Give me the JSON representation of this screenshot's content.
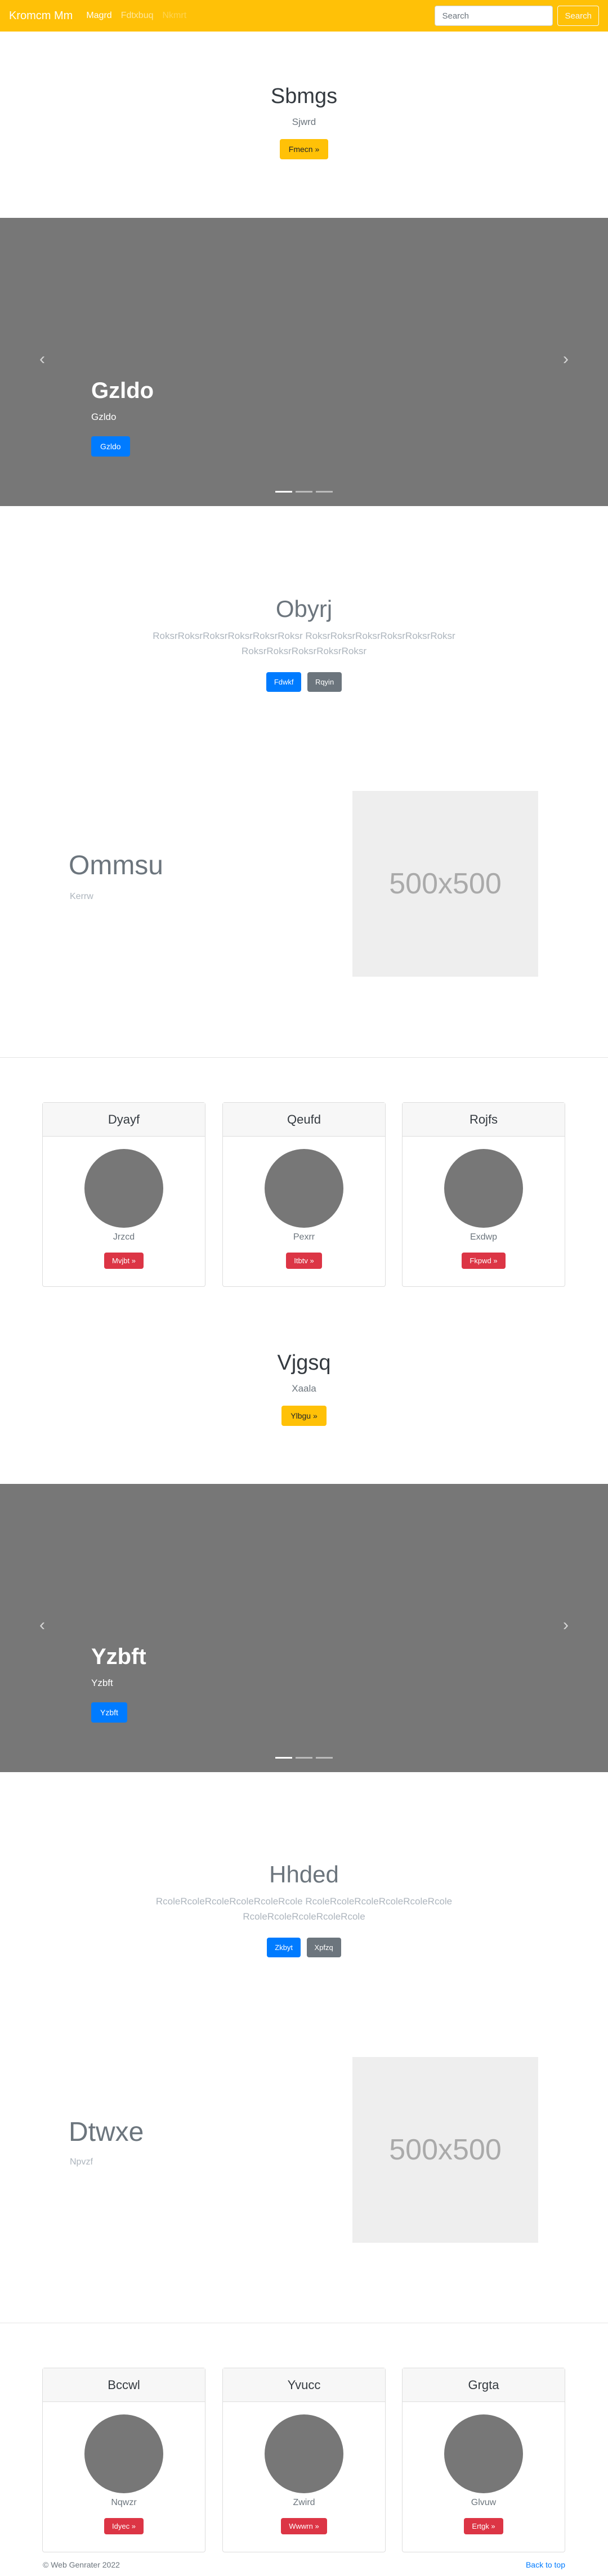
{
  "navbar": {
    "brand": "Kromcm Mm",
    "links": [
      "Magrd",
      "Fdtxbuq",
      "Nkmrt"
    ],
    "search_placeholder": "Search",
    "search_button": "Search"
  },
  "hero1": {
    "title": "Sbmgs",
    "subtitle": "Sjwrd",
    "button": "Fmecn »"
  },
  "carousel1": {
    "title": "Gzldo",
    "subtitle": "Gzldo",
    "button": "Gzldo"
  },
  "intro1": {
    "title": "Obyrj",
    "lead": "RoksrRoksrRoksrRoksrRoksrRoksr RoksrRoksrRoksrRoksrRoksrRoksr RoksrRoksrRoksrRoksrRoksr",
    "btn1": "Fdwkf",
    "btn2": "Rqyin"
  },
  "feature1": {
    "title": "Ommsu",
    "subtitle": "Kerrw",
    "placeholder": "500x500"
  },
  "cards1": [
    {
      "title": "Dyayf",
      "text": "Jrzcd",
      "button": "Mvjbt »"
    },
    {
      "title": "Qeufd",
      "text": "Pexrr",
      "button": "Itbtv »"
    },
    {
      "title": "Rojfs",
      "text": "Exdwp",
      "button": "Fkpwd »"
    }
  ],
  "hero2": {
    "title": "Vjgsq",
    "subtitle": "Xaala",
    "button": "Ylbgu »"
  },
  "carousel2": {
    "title": "Yzbft",
    "subtitle": "Yzbft",
    "button": "Yzbft"
  },
  "intro2": {
    "title": "Hhded",
    "lead": "RcoleRcoleRcoleRcoleRcoleRcole RcoleRcoleRcoleRcoleRcoleRcole RcoleRcoleRcoleRcoleRcole",
    "btn1": "Zkbyt",
    "btn2": "Xpfzq"
  },
  "feature2": {
    "title": "Dtwxe",
    "subtitle": "Npvzf",
    "placeholder": "500x500"
  },
  "cards2": [
    {
      "title": "Bccwl",
      "text": "Nqwzr",
      "button": "Idyec »"
    },
    {
      "title": "Yvucc",
      "text": "Zwird",
      "button": "Wwwrn »"
    },
    {
      "title": "Grgta",
      "text": "Glvuw",
      "button": "Ertgk »"
    }
  ],
  "footer": {
    "copyright": "© Web Genrater 2022",
    "back_to_top": "Back to top"
  },
  "colors": {
    "navbar": "#ffc107",
    "primary": "#007bff",
    "secondary": "#6c757d",
    "danger": "#dc3545",
    "carousel_bg": "#777777"
  }
}
